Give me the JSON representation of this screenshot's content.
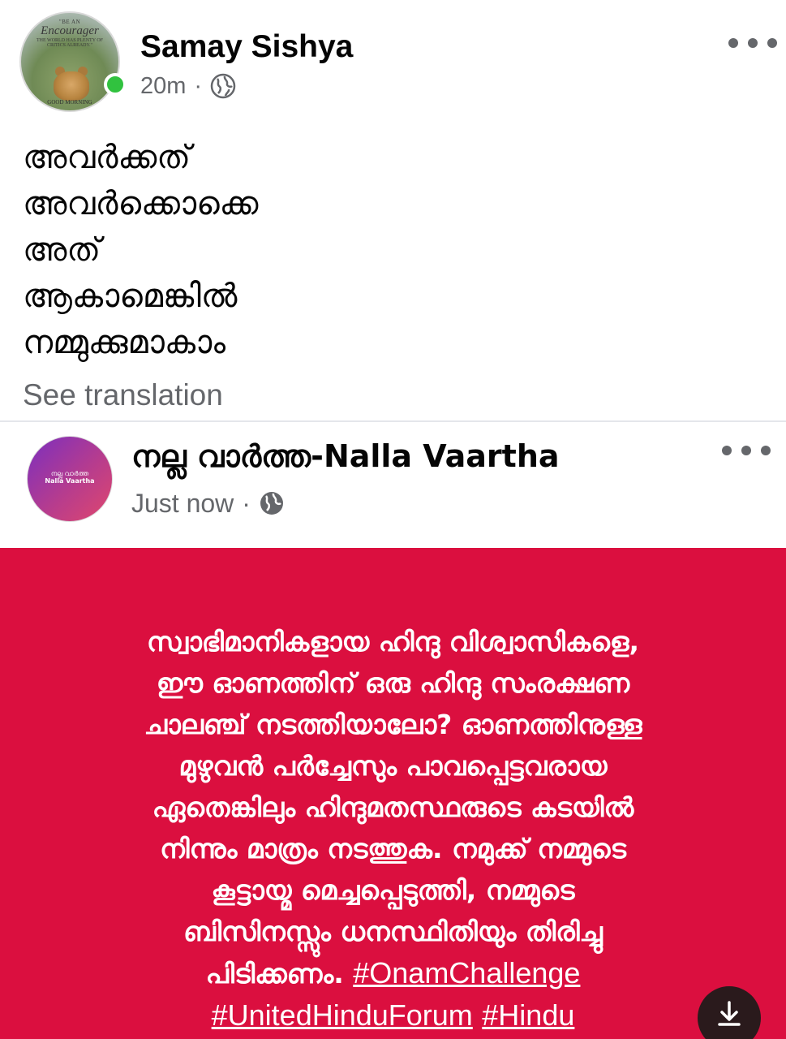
{
  "colors": {
    "online": "#31c23f",
    "meta_gray": "#65676b",
    "card_red": "#db0f3f",
    "text_dark": "#050505"
  },
  "post": {
    "author": "Samay Sishya",
    "time": "20m",
    "separator": "·",
    "privacy_icon": "globe-icon",
    "avatar_quote": {
      "line1": "\"BE AN",
      "line2": "Encourager",
      "line3": "THE WORLD HAS PLENTY OF",
      "line4": "CRITICS ALREADY.\"",
      "footer": "GOOD MORNING"
    },
    "text_lines": [
      "അവർക്കത്",
      "അവർക്കൊക്കെ",
      "അത്",
      "ആകാമെങ്കിൽ",
      "നമ്മുക്കുമാകാം"
    ],
    "see_translation": "See translation"
  },
  "shared": {
    "page_name": "നല്ല വാർത്ത-Nalla Vaartha",
    "avatar_text_line1": "നല്ല വാർത്ത",
    "avatar_text_line2": "Nalla Vaartha",
    "time": "Just now",
    "separator": "·",
    "privacy_icon": "globe-icon",
    "image_text_lines": [
      "സ്വാഭിമാനികളായ ഹിന്ദു വിശ്വാസികളെ,",
      "ഈ ഓണത്തിന് ഒരു ഹിന്ദു സംരക്ഷണ",
      "ചാലഞ്ച് നടത്തിയാലോ? ഓണത്തിനുള്ള",
      "മുഴുവൻ പർച്ചേസും പാവപ്പെട്ടവരായ",
      "ഏതെങ്കിലും ഹിന്ദുമതസ്ഥരുടെ കടയിൽ",
      "നിന്നും മാത്രം നടത്തുക. നമുക്ക് നമ്മുടെ",
      "കൂട്ടായ്മ മെച്ചപ്പെടുത്തി, നമ്മുടെ",
      "ബിസിനസ്സും ധനസ്ഥിതിയും തിരിച്ചു"
    ],
    "last_line_text": "പിടിക്കണം.",
    "hashtags": [
      "#OnamChallenge",
      "#UnitedHinduForum",
      "#Hindu"
    ],
    "download_icon": "download-icon"
  }
}
